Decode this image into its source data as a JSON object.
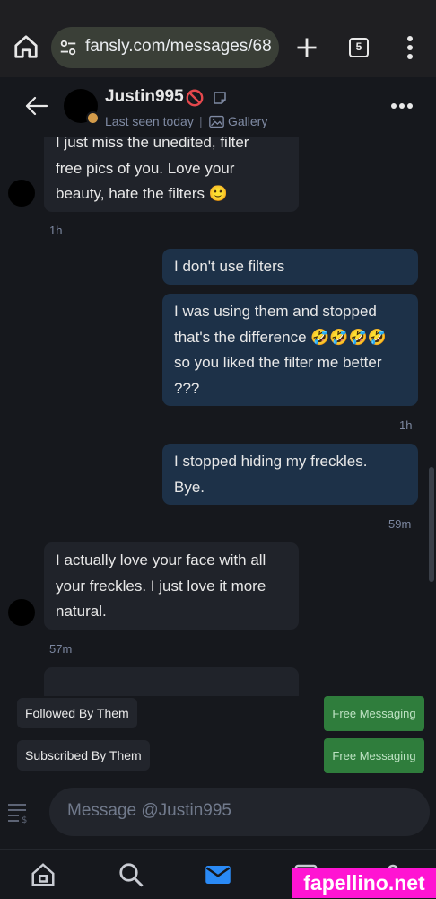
{
  "browser": {
    "url": "fansly.com/messages/68",
    "tab_count": "5"
  },
  "header": {
    "username": "Justin995",
    "last_seen": "Last seen today",
    "separator": "|",
    "gallery_label": "Gallery",
    "presence_color": "#d39b4a"
  },
  "messages": [
    {
      "direction": "in",
      "text": "I just miss the unedited, filter\nfree pics of you. Love your\nbeauty, hate the filters 🙂"
    },
    {
      "direction": "out",
      "text": "I don't use filters"
    },
    {
      "direction": "out",
      "text": "I was using them and stopped\nthat's the difference 🤣🤣🤣🤣\nso you liked the filter me better\n???"
    },
    {
      "direction": "out",
      "text": "I stopped hiding my freckles.\nBye."
    },
    {
      "direction": "in",
      "text": "I actually love your face with all\nyour freckles. I just love it more\nnatural."
    }
  ],
  "timestamps": [
    "1h",
    "1h",
    "59m",
    "57m"
  ],
  "status": {
    "followed_label": "Followed By Them",
    "subscribed_label": "Subscribed By Them",
    "free_messaging_label": "Free Messaging",
    "free_messaging_color": "#2f7d3c"
  },
  "composer": {
    "placeholder": "Message @Justin995"
  },
  "nav": {
    "active": "messages",
    "active_color": "#2a8af6"
  },
  "watermark": "fapellino.net",
  "icons": [
    "home-icon",
    "tune-icon",
    "plus-icon",
    "tabs-icon",
    "kebab-icon",
    "back-arrow-icon",
    "blocked-icon",
    "note-icon",
    "gallery-icon",
    "more-icon",
    "menu-list-icon",
    "search-icon",
    "mail-icon"
  ]
}
